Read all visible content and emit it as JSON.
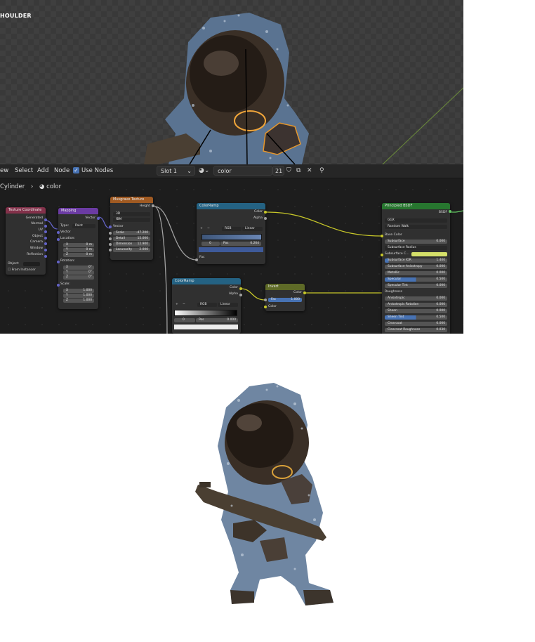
{
  "viewport": {
    "label": "HOULDER"
  },
  "node_editor": {
    "menu": [
      "ew",
      "Select",
      "Add",
      "Node"
    ],
    "use_nodes": "Use Nodes",
    "slot": "Slot 1",
    "material_name": "color",
    "user_count": "21",
    "breadcrumb": {
      "object": "Cylinder",
      "material": "color"
    },
    "nodes": {
      "texcoord": {
        "title": "Texture Coordinate",
        "outputs": [
          "Generated",
          "Normal",
          "UV",
          "Object",
          "Camera",
          "Window",
          "Reflection"
        ],
        "object_label": "Object:",
        "from_instancer": "From Instancer"
      },
      "mapping": {
        "title": "Mapping",
        "out": "Vector",
        "type_label": "Type:",
        "type_value": "Point",
        "vector": "Vector",
        "location": "Location:",
        "loc": [
          "0 m",
          "0 m",
          "0 m"
        ],
        "rotation": "Rotation:",
        "rot": [
          "0°",
          "0°",
          "0°"
        ],
        "scale": "Scale:",
        "scl": [
          "1.000",
          "1.000",
          "1.000"
        ],
        "axes": [
          "X",
          "Y",
          "Z"
        ]
      },
      "musgrave": {
        "title": "Musgrave Texture",
        "out": "Height",
        "dims": "3D",
        "type": "fBM",
        "vector": "Vector",
        "fields": [
          {
            "label": "Scale",
            "value": "-47.200"
          },
          {
            "label": "Detail",
            "value": "15.000"
          },
          {
            "label": "Dimension",
            "value": "12.900"
          },
          {
            "label": "Lacunarity",
            "value": "2.000"
          }
        ]
      },
      "ramp1": {
        "title": "ColorRamp",
        "out_color": "Color",
        "out_alpha": "Alpha",
        "plus": "+",
        "minus": "−",
        "mode": "RGB",
        "interp": "Linear",
        "index": "0",
        "pos_label": "Pos",
        "pos_value": "0.264",
        "fac": "Fac"
      },
      "ramp2": {
        "title": "ColorRamp",
        "out_color": "Color",
        "out_alpha": "Alpha",
        "plus": "+",
        "minus": "−",
        "mode": "RGB",
        "interp": "Linear",
        "index": "0",
        "pos_label": "Pos",
        "pos_value": "0.000"
      },
      "invert": {
        "title": "Invert",
        "out": "Color",
        "fac_label": "Fac",
        "fac_value": "1.000",
        "in_color": "Color"
      },
      "bsdf": {
        "title": "Principled BSDF",
        "out": "BSDF",
        "distribution": "GGX",
        "subsurface_method": "Random Walk",
        "rows": [
          {
            "label": "Base Color",
            "value": ""
          },
          {
            "label": "Subsurface",
            "value": "0.000"
          },
          {
            "label": "Subsurface Radius",
            "value": ""
          },
          {
            "label": "Subsurface C...",
            "value": ""
          },
          {
            "label": "Subsurface IOR",
            "value": "1.400"
          },
          {
            "label": "Subsurface Anisotropy",
            "value": "0.000"
          },
          {
            "label": "Metallic",
            "value": "0.000"
          },
          {
            "label": "Specular",
            "value": "0.500"
          },
          {
            "label": "Specular Tint",
            "value": "0.000"
          },
          {
            "label": "Roughness",
            "value": ""
          },
          {
            "label": "Anisotropic",
            "value": "0.000"
          },
          {
            "label": "Anisotropic Rotation",
            "value": "0.000"
          },
          {
            "label": "Sheen",
            "value": "0.000"
          },
          {
            "label": "Sheen Tint",
            "value": "0.500"
          },
          {
            "label": "Clearcoat",
            "value": "0.000"
          },
          {
            "label": "Clearcoat Roughness",
            "value": "0.030"
          }
        ]
      }
    }
  },
  "colors": {
    "accent": "#4772b3",
    "texcoord_header": "#83314a",
    "input_header": "#6b3ba3",
    "texture_header": "#a05a22",
    "converter_header": "#246283",
    "invert_header": "#5e6a27",
    "shader_header": "#27762f",
    "subsurface_color": "#d5e06a"
  }
}
